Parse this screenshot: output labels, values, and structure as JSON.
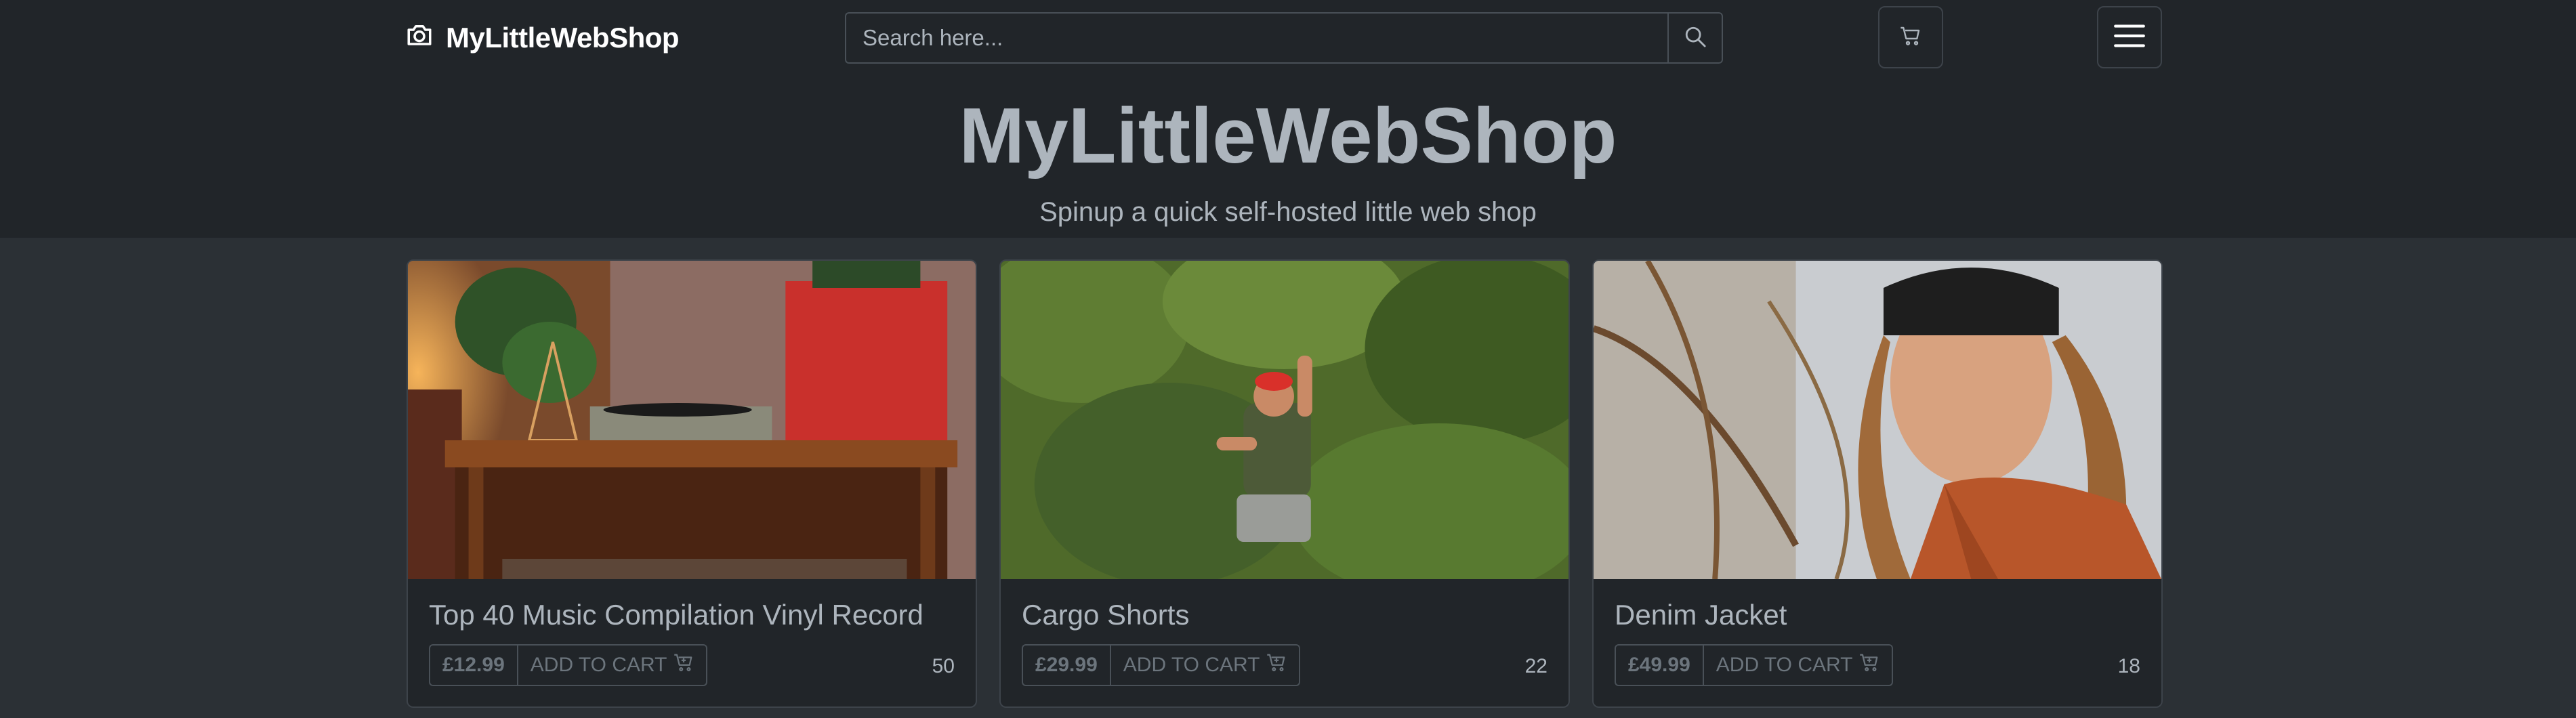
{
  "brand": {
    "name": "MyLittleWebShop",
    "icon": "camera-icon"
  },
  "search": {
    "placeholder": "Search here...",
    "icon": "search-icon"
  },
  "header": {
    "cart_icon": "cart-icon",
    "menu_icon": "hamburger-menu-icon"
  },
  "hero": {
    "title": "MyLittleWebShop",
    "subtitle": "Spinup a quick self-hosted little web shop"
  },
  "products": [
    {
      "name": "Top 40 Music Compilation Vinyl Record",
      "price": "£12.99",
      "add_label": "ADD TO CART",
      "stock": "50"
    },
    {
      "name": "Cargo Shorts",
      "price": "£29.99",
      "add_label": "ADD TO CART",
      "stock": "22"
    },
    {
      "name": "Denim Jacket",
      "price": "£49.99",
      "add_label": "ADD TO CART",
      "stock": "18"
    }
  ],
  "colors": {
    "page_bg": "#2b3035",
    "header_bg": "#212529",
    "muted_text": "#adb5bd",
    "border": "#495057"
  }
}
